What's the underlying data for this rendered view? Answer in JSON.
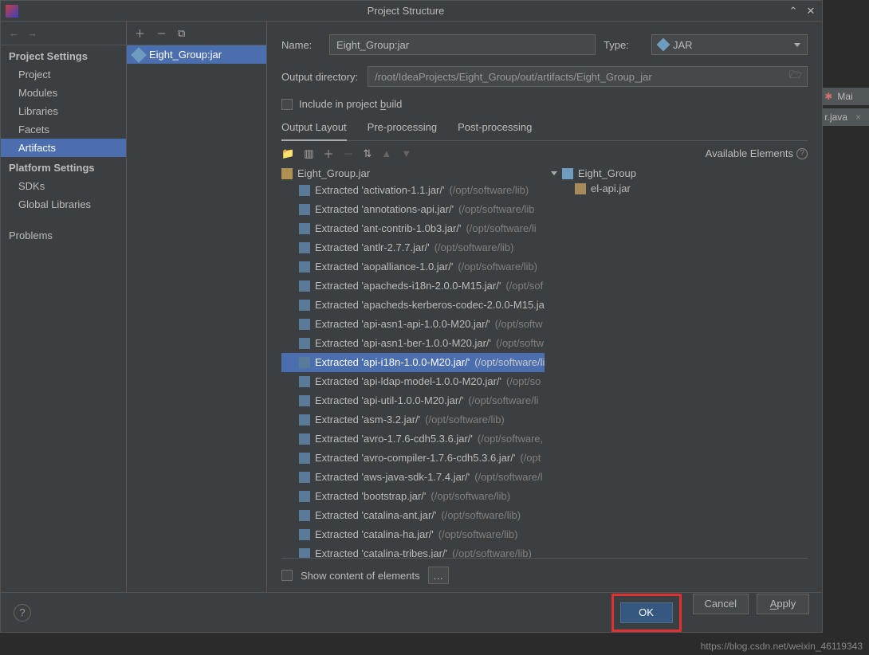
{
  "window": {
    "title": "Project Structure"
  },
  "sidebar": {
    "project_settings_header": "Project Settings",
    "items": [
      "Project",
      "Modules",
      "Libraries",
      "Facets",
      "Artifacts"
    ],
    "selected": 4,
    "platform_settings_header": "Platform Settings",
    "platform_items": [
      "SDKs",
      "Global Libraries"
    ],
    "problems": "Problems"
  },
  "artifact_list": {
    "item": "Eight_Group:jar"
  },
  "form": {
    "name_label": "Name:",
    "name_value": "Eight_Group:jar",
    "type_label": "Type:",
    "type_value": "JAR",
    "outdir_label": "Output directory:",
    "outdir_value": "/root/IdeaProjects/Eight_Group/out/artifacts/Eight_Group_jar",
    "include_build": "Include in project build"
  },
  "tabs": [
    "Output Layout",
    "Pre-processing",
    "Post-processing"
  ],
  "active_tab": 0,
  "avail_label": "Available Elements",
  "tree": {
    "root": "Eight_Group.jar",
    "items": [
      {
        "t": "Extracted 'activation-1.1.jar/'",
        "g": "(/opt/software/lib)"
      },
      {
        "t": "Extracted 'annotations-api.jar/'",
        "g": "(/opt/software/lib"
      },
      {
        "t": "Extracted 'ant-contrib-1.0b3.jar/'",
        "g": "(/opt/software/li"
      },
      {
        "t": "Extracted 'antlr-2.7.7.jar/'",
        "g": "(/opt/software/lib)"
      },
      {
        "t": "Extracted 'aopalliance-1.0.jar/'",
        "g": "(/opt/software/lib)"
      },
      {
        "t": "Extracted 'apacheds-i18n-2.0.0-M15.jar/'",
        "g": "(/opt/sof"
      },
      {
        "t": "Extracted 'apacheds-kerberos-codec-2.0.0-M15.ja",
        "g": ""
      },
      {
        "t": "Extracted 'api-asn1-api-1.0.0-M20.jar/'",
        "g": "(/opt/softw"
      },
      {
        "t": "Extracted 'api-asn1-ber-1.0.0-M20.jar/'",
        "g": "(/opt/softw"
      },
      {
        "t": "Extracted 'api-i18n-1.0.0-M20.jar/'",
        "g": "(/opt/software/lib)",
        "sel": true
      },
      {
        "t": "Extracted 'api-ldap-model-1.0.0-M20.jar/'",
        "g": "(/opt/so"
      },
      {
        "t": "Extracted 'api-util-1.0.0-M20.jar/'",
        "g": "(/opt/software/li"
      },
      {
        "t": "Extracted 'asm-3.2.jar/'",
        "g": "(/opt/software/lib)"
      },
      {
        "t": "Extracted 'avro-1.7.6-cdh5.3.6.jar/'",
        "g": "(/opt/software,"
      },
      {
        "t": "Extracted 'avro-compiler-1.7.6-cdh5.3.6.jar/'",
        "g": "(/opt"
      },
      {
        "t": "Extracted 'aws-java-sdk-1.7.4.jar/'",
        "g": "(/opt/software/l"
      },
      {
        "t": "Extracted 'bootstrap.jar/'",
        "g": "(/opt/software/lib)"
      },
      {
        "t": "Extracted 'catalina-ant.jar/'",
        "g": "(/opt/software/lib)"
      },
      {
        "t": "Extracted 'catalina-ha.jar/'",
        "g": "(/opt/software/lib)"
      },
      {
        "t": "Extracted 'catalina-tribes.jar/'",
        "g": "(/opt/software/lib)"
      }
    ]
  },
  "avail_tree": {
    "root": "Eight_Group",
    "child": "el-api.jar"
  },
  "show_content": "Show content of elements",
  "buttons": {
    "ok": "OK",
    "cancel": "Cancel",
    "apply": "Apply"
  },
  "background": {
    "tab1": "Mai",
    "tab2": "r.java"
  },
  "watermark": "https://blog.csdn.net/weixin_46119343"
}
